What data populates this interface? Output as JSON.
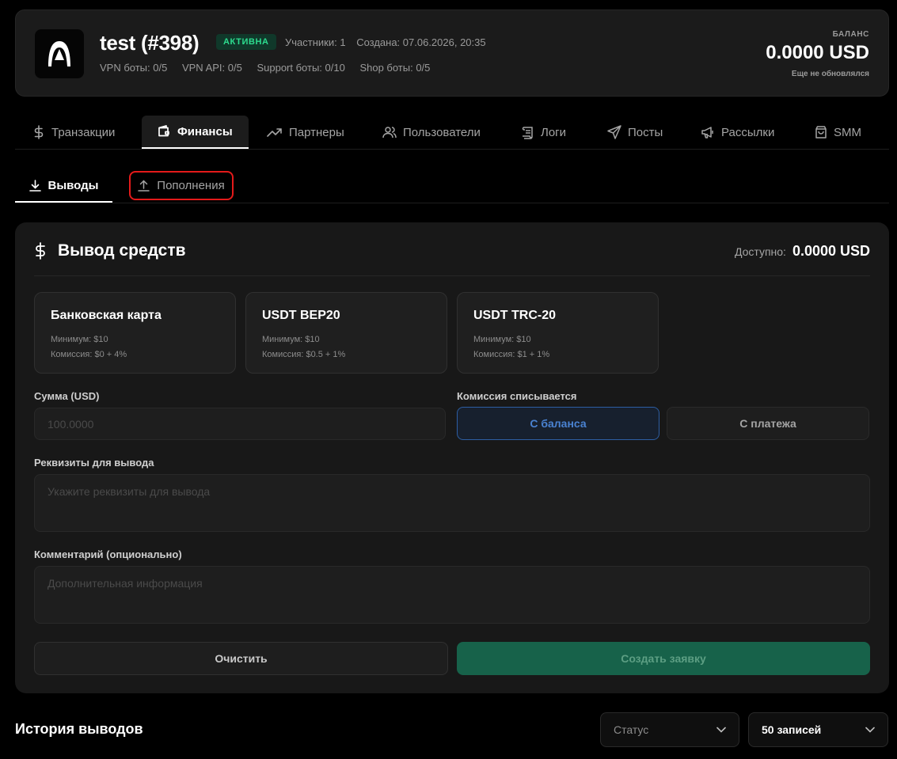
{
  "header": {
    "name": "test",
    "id": "(#398)",
    "status_badge": "АКТИВНА",
    "participants": "Участники: 1",
    "created": "Создана: 07.06.2026, 20:35",
    "vpn_bots": "VPN боты: 0/5",
    "vpn_api": "VPN API: 0/5",
    "support_bots": "Support боты: 0/10",
    "shop_bots": "Shop боты: 0/5",
    "balance_label": "БАЛАНС",
    "balance_value": "0.0000 USD",
    "balance_note": "Еще не обновлялся"
  },
  "main_tabs": [
    {
      "label": "Транзакции",
      "icon": "dollar-icon",
      "active": false
    },
    {
      "label": "Финансы",
      "icon": "wallet-icon",
      "active": true
    },
    {
      "label": "Партнеры",
      "icon": "trending-up-icon",
      "active": false
    },
    {
      "label": "Пользователи",
      "icon": "users-icon",
      "active": false
    },
    {
      "label": "Логи",
      "icon": "scroll-icon",
      "active": false
    },
    {
      "label": "Посты",
      "icon": "send-icon",
      "active": false
    },
    {
      "label": "Рассылки",
      "icon": "megaphone-icon",
      "active": false
    },
    {
      "label": "SMM",
      "icon": "shopping-bag-icon",
      "active": false
    }
  ],
  "sub_tabs": [
    {
      "label": "Выводы",
      "icon": "download-icon",
      "active": true
    },
    {
      "label": "Пополнения",
      "icon": "upload-icon",
      "active": false,
      "highlighted": true,
      "highlight_color": "#e41a1a"
    }
  ],
  "withdraw": {
    "title": "Вывод средств",
    "available_label": "Доступно:",
    "available_value": "0.0000 USD",
    "methods": [
      {
        "name": "Банковская карта",
        "min": "Минимум: $10",
        "fee": "Комиссия: $0 + 4%"
      },
      {
        "name": "USDT BEP20",
        "min": "Минимум: $10",
        "fee": "Комиссия: $0.5 + 1%"
      },
      {
        "name": "USDT TRC-20",
        "min": "Минимум: $10",
        "fee": "Комиссия: $1 + 1%"
      }
    ],
    "amount_label": "Сумма (USD)",
    "amount_placeholder": "100.0000",
    "fee_source_label": "Комиссия списывается",
    "fee_from_balance": "С баланса",
    "fee_from_payment": "С платежа",
    "requisites_label": "Реквизиты для вывода",
    "requisites_placeholder": "Укажите реквизиты для вывода",
    "comment_label": "Комментарий (опционально)",
    "comment_placeholder": "Дополнительная информация",
    "clear_button": "Очистить",
    "submit_button": "Создать заявку"
  },
  "history": {
    "title": "История выводов",
    "status_select": "Статус",
    "count_select": "50 записей"
  },
  "colors": {
    "accent_green": "#17624a",
    "active_badge": "#2ddc8f",
    "selected_blue": "#2d5ea3",
    "highlight_red": "#e41a1a"
  }
}
